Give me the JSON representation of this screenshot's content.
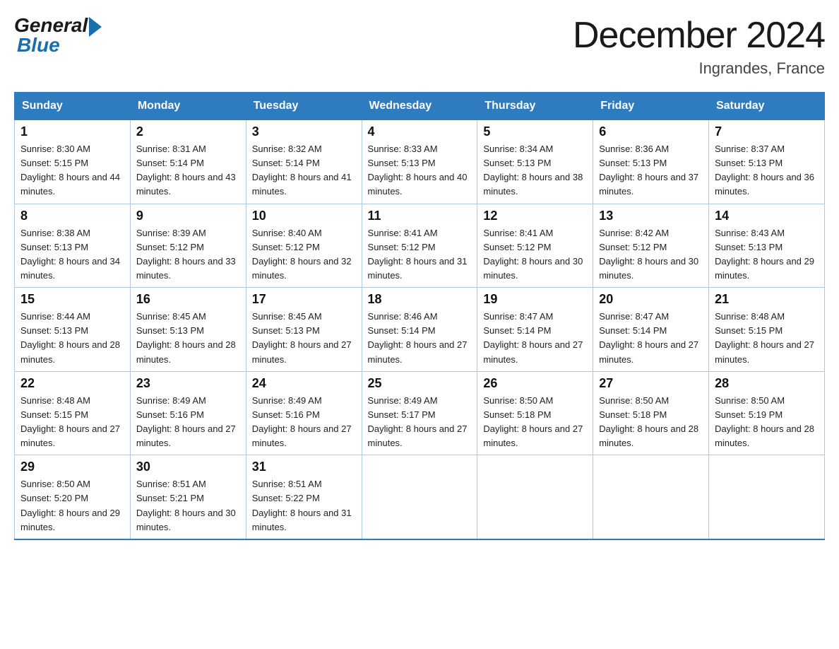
{
  "header": {
    "logo_general": "General",
    "logo_blue": "Blue",
    "month_title": "December 2024",
    "location": "Ingrandes, France"
  },
  "columns": [
    "Sunday",
    "Monday",
    "Tuesday",
    "Wednesday",
    "Thursday",
    "Friday",
    "Saturday"
  ],
  "weeks": [
    [
      {
        "day": "1",
        "sunrise": "Sunrise: 8:30 AM",
        "sunset": "Sunset: 5:15 PM",
        "daylight": "Daylight: 8 hours and 44 minutes."
      },
      {
        "day": "2",
        "sunrise": "Sunrise: 8:31 AM",
        "sunset": "Sunset: 5:14 PM",
        "daylight": "Daylight: 8 hours and 43 minutes."
      },
      {
        "day": "3",
        "sunrise": "Sunrise: 8:32 AM",
        "sunset": "Sunset: 5:14 PM",
        "daylight": "Daylight: 8 hours and 41 minutes."
      },
      {
        "day": "4",
        "sunrise": "Sunrise: 8:33 AM",
        "sunset": "Sunset: 5:13 PM",
        "daylight": "Daylight: 8 hours and 40 minutes."
      },
      {
        "day": "5",
        "sunrise": "Sunrise: 8:34 AM",
        "sunset": "Sunset: 5:13 PM",
        "daylight": "Daylight: 8 hours and 38 minutes."
      },
      {
        "day": "6",
        "sunrise": "Sunrise: 8:36 AM",
        "sunset": "Sunset: 5:13 PM",
        "daylight": "Daylight: 8 hours and 37 minutes."
      },
      {
        "day": "7",
        "sunrise": "Sunrise: 8:37 AM",
        "sunset": "Sunset: 5:13 PM",
        "daylight": "Daylight: 8 hours and 36 minutes."
      }
    ],
    [
      {
        "day": "8",
        "sunrise": "Sunrise: 8:38 AM",
        "sunset": "Sunset: 5:13 PM",
        "daylight": "Daylight: 8 hours and 34 minutes."
      },
      {
        "day": "9",
        "sunrise": "Sunrise: 8:39 AM",
        "sunset": "Sunset: 5:12 PM",
        "daylight": "Daylight: 8 hours and 33 minutes."
      },
      {
        "day": "10",
        "sunrise": "Sunrise: 8:40 AM",
        "sunset": "Sunset: 5:12 PM",
        "daylight": "Daylight: 8 hours and 32 minutes."
      },
      {
        "day": "11",
        "sunrise": "Sunrise: 8:41 AM",
        "sunset": "Sunset: 5:12 PM",
        "daylight": "Daylight: 8 hours and 31 minutes."
      },
      {
        "day": "12",
        "sunrise": "Sunrise: 8:41 AM",
        "sunset": "Sunset: 5:12 PM",
        "daylight": "Daylight: 8 hours and 30 minutes."
      },
      {
        "day": "13",
        "sunrise": "Sunrise: 8:42 AM",
        "sunset": "Sunset: 5:12 PM",
        "daylight": "Daylight: 8 hours and 30 minutes."
      },
      {
        "day": "14",
        "sunrise": "Sunrise: 8:43 AM",
        "sunset": "Sunset: 5:13 PM",
        "daylight": "Daylight: 8 hours and 29 minutes."
      }
    ],
    [
      {
        "day": "15",
        "sunrise": "Sunrise: 8:44 AM",
        "sunset": "Sunset: 5:13 PM",
        "daylight": "Daylight: 8 hours and 28 minutes."
      },
      {
        "day": "16",
        "sunrise": "Sunrise: 8:45 AM",
        "sunset": "Sunset: 5:13 PM",
        "daylight": "Daylight: 8 hours and 28 minutes."
      },
      {
        "day": "17",
        "sunrise": "Sunrise: 8:45 AM",
        "sunset": "Sunset: 5:13 PM",
        "daylight": "Daylight: 8 hours and 27 minutes."
      },
      {
        "day": "18",
        "sunrise": "Sunrise: 8:46 AM",
        "sunset": "Sunset: 5:14 PM",
        "daylight": "Daylight: 8 hours and 27 minutes."
      },
      {
        "day": "19",
        "sunrise": "Sunrise: 8:47 AM",
        "sunset": "Sunset: 5:14 PM",
        "daylight": "Daylight: 8 hours and 27 minutes."
      },
      {
        "day": "20",
        "sunrise": "Sunrise: 8:47 AM",
        "sunset": "Sunset: 5:14 PM",
        "daylight": "Daylight: 8 hours and 27 minutes."
      },
      {
        "day": "21",
        "sunrise": "Sunrise: 8:48 AM",
        "sunset": "Sunset: 5:15 PM",
        "daylight": "Daylight: 8 hours and 27 minutes."
      }
    ],
    [
      {
        "day": "22",
        "sunrise": "Sunrise: 8:48 AM",
        "sunset": "Sunset: 5:15 PM",
        "daylight": "Daylight: 8 hours and 27 minutes."
      },
      {
        "day": "23",
        "sunrise": "Sunrise: 8:49 AM",
        "sunset": "Sunset: 5:16 PM",
        "daylight": "Daylight: 8 hours and 27 minutes."
      },
      {
        "day": "24",
        "sunrise": "Sunrise: 8:49 AM",
        "sunset": "Sunset: 5:16 PM",
        "daylight": "Daylight: 8 hours and 27 minutes."
      },
      {
        "day": "25",
        "sunrise": "Sunrise: 8:49 AM",
        "sunset": "Sunset: 5:17 PM",
        "daylight": "Daylight: 8 hours and 27 minutes."
      },
      {
        "day": "26",
        "sunrise": "Sunrise: 8:50 AM",
        "sunset": "Sunset: 5:18 PM",
        "daylight": "Daylight: 8 hours and 27 minutes."
      },
      {
        "day": "27",
        "sunrise": "Sunrise: 8:50 AM",
        "sunset": "Sunset: 5:18 PM",
        "daylight": "Daylight: 8 hours and 28 minutes."
      },
      {
        "day": "28",
        "sunrise": "Sunrise: 8:50 AM",
        "sunset": "Sunset: 5:19 PM",
        "daylight": "Daylight: 8 hours and 28 minutes."
      }
    ],
    [
      {
        "day": "29",
        "sunrise": "Sunrise: 8:50 AM",
        "sunset": "Sunset: 5:20 PM",
        "daylight": "Daylight: 8 hours and 29 minutes."
      },
      {
        "day": "30",
        "sunrise": "Sunrise: 8:51 AM",
        "sunset": "Sunset: 5:21 PM",
        "daylight": "Daylight: 8 hours and 30 minutes."
      },
      {
        "day": "31",
        "sunrise": "Sunrise: 8:51 AM",
        "sunset": "Sunset: 5:22 PM",
        "daylight": "Daylight: 8 hours and 31 minutes."
      },
      {
        "day": "",
        "sunrise": "",
        "sunset": "",
        "daylight": ""
      },
      {
        "day": "",
        "sunrise": "",
        "sunset": "",
        "daylight": ""
      },
      {
        "day": "",
        "sunrise": "",
        "sunset": "",
        "daylight": ""
      },
      {
        "day": "",
        "sunrise": "",
        "sunset": "",
        "daylight": ""
      }
    ]
  ]
}
